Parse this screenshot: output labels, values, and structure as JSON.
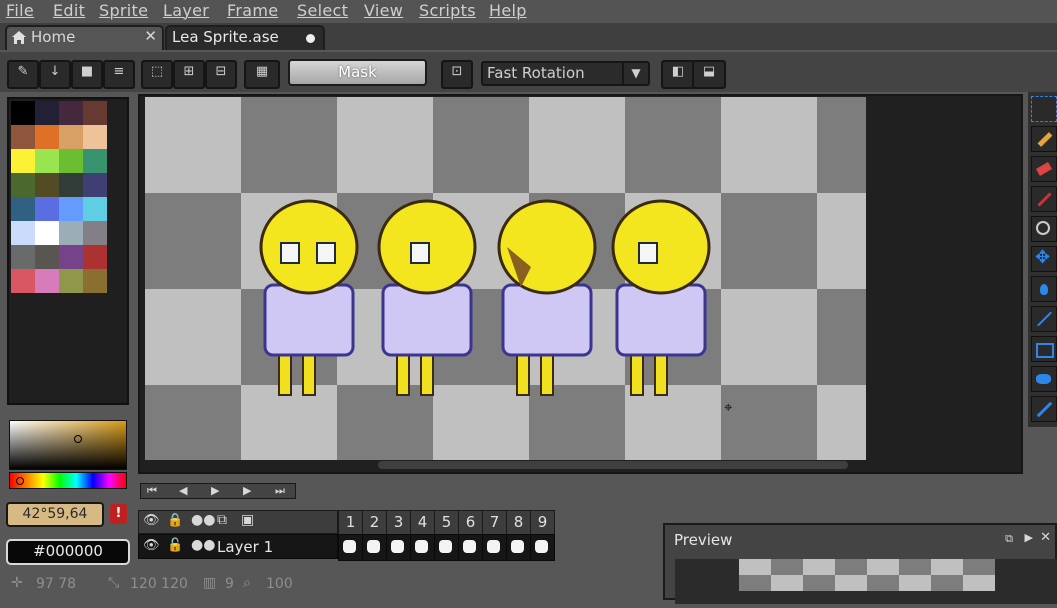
{
  "menu": [
    "File",
    "Edit",
    "Sprite",
    "Layer",
    "Frame",
    "Select",
    "View",
    "Scripts",
    "Help"
  ],
  "tabs": {
    "home_label": "Home",
    "sprite_label": "Lea Sprite.ase"
  },
  "toolbar": {
    "mask_label": "Mask",
    "rotation_value": "Fast Rotation"
  },
  "colors": {
    "fg_label": "42°59,64",
    "hex_value": "#000000",
    "accent": "#2d87ea"
  },
  "palette": [
    "#000000",
    "#222034",
    "#45283c",
    "#663931",
    "#8f563b",
    "#df7126",
    "#d9a066",
    "#eec39a",
    "#fbf236",
    "#99e550",
    "#6abe30",
    "#37946e",
    "#4b692f",
    "#524b24",
    "#323c39",
    "#3f3f74",
    "#306082",
    "#5b6ee1",
    "#639bff",
    "#5fcde4",
    "#cbdbfc",
    "#ffffff",
    "#9badb7",
    "#847e87",
    "#696a6a",
    "#595652",
    "#76428a",
    "#ac3232",
    "#d95763",
    "#d77bba",
    "#8f974a",
    "#8a6f30"
  ],
  "timeline": {
    "layer_name": "Layer 1",
    "frames": [
      "1",
      "2",
      "3",
      "4",
      "5",
      "6",
      "7",
      "8",
      "9"
    ]
  },
  "preview": {
    "title": "Preview"
  },
  "status": {
    "position": "97 78",
    "size": "120 120",
    "frames": "9",
    "zoom": "100"
  }
}
